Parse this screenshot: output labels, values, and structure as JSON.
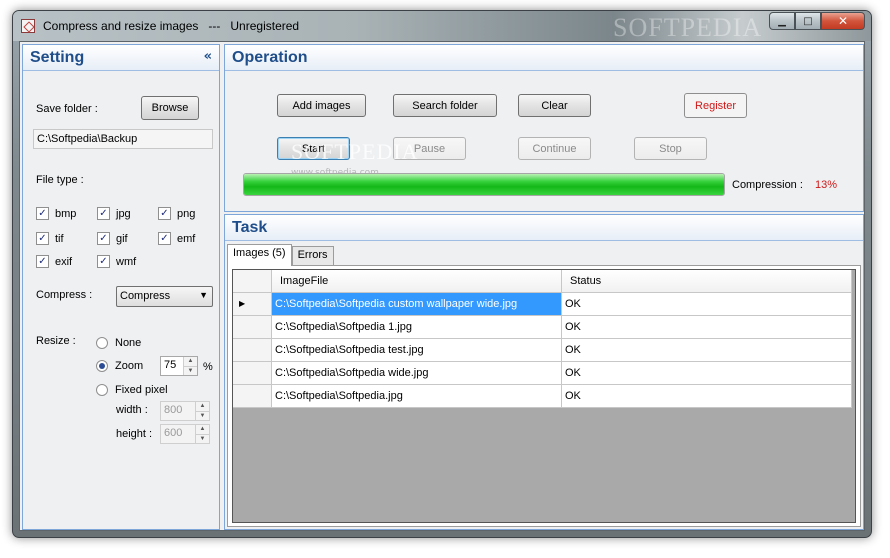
{
  "window": {
    "title": "Compress and resize images   ---   Unregistered",
    "watermark": "SOFTPEDIA",
    "controls": {
      "minimize": "▁",
      "maximize": "□",
      "close": "✕"
    }
  },
  "setting": {
    "title": "Setting",
    "collapse": "«",
    "save_folder_label": "Save folder :",
    "browse_label": "Browse",
    "save_folder_value": "C:\\Softpedia\\Backup",
    "file_type_label": "File type :",
    "file_types": [
      {
        "label": "bmp",
        "checked": true
      },
      {
        "label": "jpg",
        "checked": true
      },
      {
        "label": "png",
        "checked": true
      },
      {
        "label": "tif",
        "checked": true
      },
      {
        "label": "gif",
        "checked": true
      },
      {
        "label": "emf",
        "checked": true
      },
      {
        "label": "exif",
        "checked": true
      },
      {
        "label": "wmf",
        "checked": true
      }
    ],
    "check_mark": "✓",
    "compress_label": "Compress :",
    "compress_value": "Compress",
    "resize_label": "Resize :",
    "resize_options": [
      "None",
      "Zoom",
      "Fixed pixel"
    ],
    "resize_selected": "Zoom",
    "zoom_value": "75",
    "zoom_unit": "%",
    "width_label": "width :",
    "width_value": "800",
    "height_label": "height :",
    "height_value": "600"
  },
  "operation": {
    "title": "Operation",
    "add_images": "Add images",
    "search_folder": "Search folder",
    "clear": "Clear",
    "register": "Register",
    "start": "Start",
    "pause": "Pause",
    "continue": "Continue",
    "stop": "Stop",
    "progress_fraction": 1.0,
    "compression_label": "Compression :",
    "compression_value": "13%",
    "compression_color": "#d01818",
    "watermark": "SOFTPEDIA",
    "watermark_url": "www.softpedia.com"
  },
  "task": {
    "title": "Task",
    "tabs": [
      "Images (5)",
      "Errors"
    ],
    "columns": [
      "ImageFile",
      "Status"
    ],
    "rows": [
      {
        "file": "C:\\Softpedia\\Softpedia custom wallpaper wide.jpg",
        "status": "OK"
      },
      {
        "file": "C:\\Softpedia\\Softpedia 1.jpg",
        "status": "OK"
      },
      {
        "file": "C:\\Softpedia\\Softpedia test.jpg",
        "status": "OK"
      },
      {
        "file": "C:\\Softpedia\\Softpedia wide.jpg",
        "status": "OK"
      },
      {
        "file": "C:\\Softpedia\\Softpedia.jpg",
        "status": "OK"
      }
    ],
    "current_row_marker": "▶"
  },
  "colors": {
    "accent": "#1f4e8a",
    "selection": "#3399ff",
    "progress": "#13b818"
  }
}
